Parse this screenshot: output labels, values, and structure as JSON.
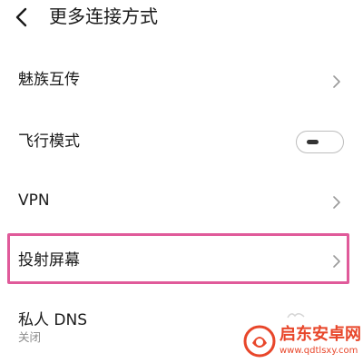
{
  "header": {
    "title": "更多连接方式",
    "back_icon": "back-arrow-icon"
  },
  "settings": {
    "meizu_share": {
      "label": "魅族互传",
      "icon": "chevron-right-icon"
    },
    "airplane_mode": {
      "label": "飞行模式",
      "toggle_state": "off"
    },
    "vpn": {
      "label": "VPN",
      "icon": "chevron-right-icon"
    },
    "screen_cast": {
      "label": "投射屏幕",
      "icon": "chevron-right-icon",
      "highlighted": true
    },
    "private_dns": {
      "label": "私人 DNS",
      "value": "关闭"
    }
  },
  "highlight": {
    "color": "#e05a9a"
  },
  "watermark": {
    "title": "启东安卓网",
    "url": "www.qdtlsxy.com",
    "color": "#e8462a"
  }
}
